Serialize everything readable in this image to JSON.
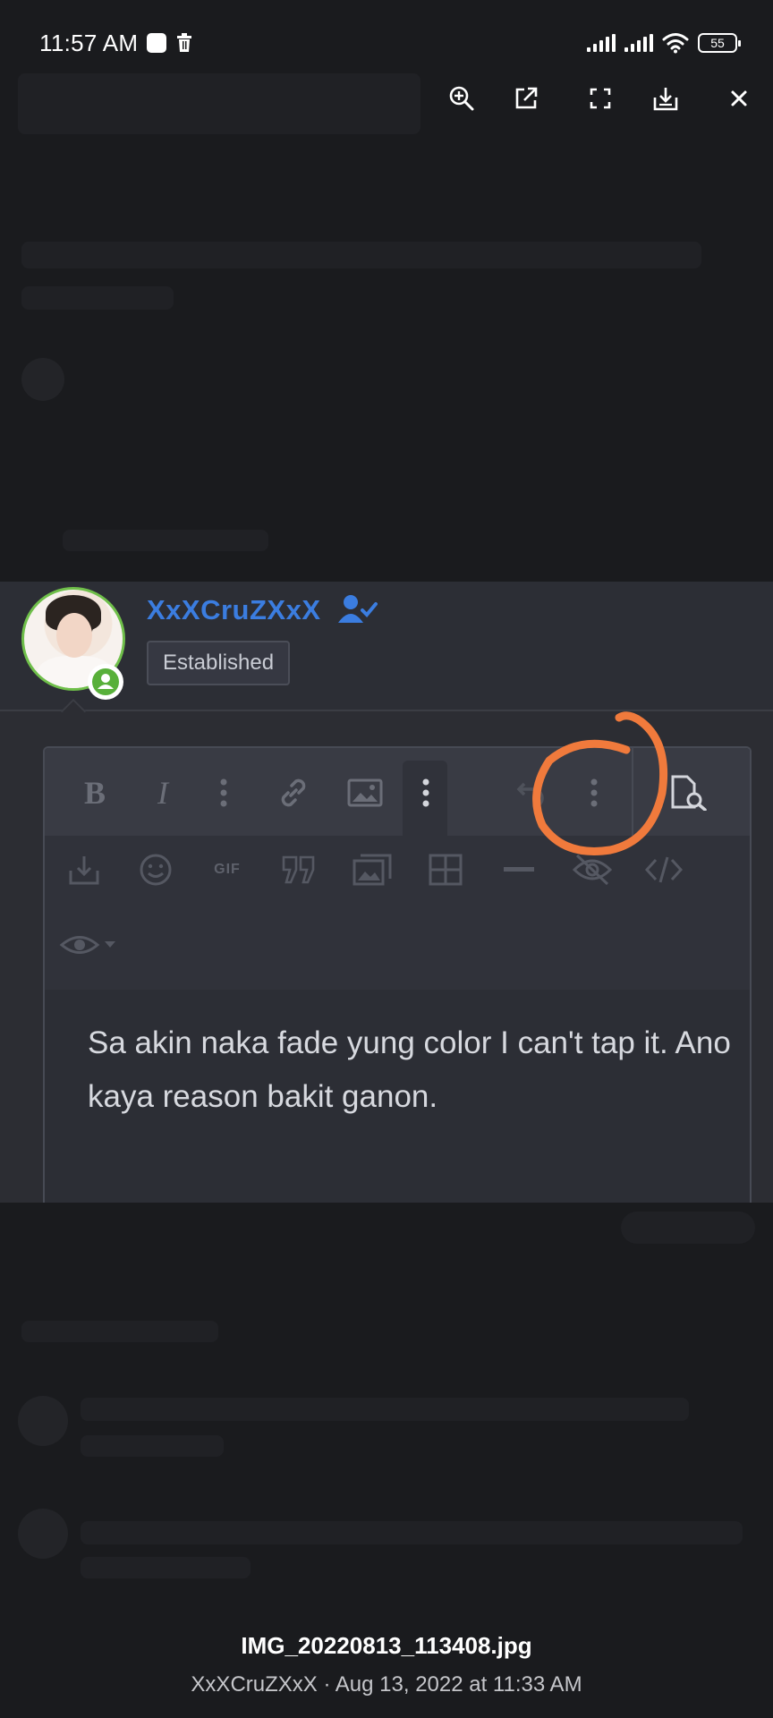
{
  "status_bar": {
    "time": "11:57 AM",
    "battery": "55"
  },
  "viewer_toolbar": {
    "icons": [
      "zoom-in-icon",
      "open-external-icon",
      "fullscreen-icon",
      "download-icon",
      "close-icon"
    ]
  },
  "post": {
    "username": "XxXCruZXxX",
    "rank": "Established",
    "accent_color": "#3b7de0",
    "online_color": "#58b03a",
    "editor_text": "Sa akin naka fade yung color I can't tap it. Ano kaya reason bakit ganon.",
    "toolbar_row1": [
      "B",
      "I"
    ],
    "gif_label": "GIF"
  },
  "annotation": {
    "color": "#f07a3c"
  },
  "caption": {
    "file_name": "IMG_20220813_113408.jpg",
    "meta": "XxXCruZXxX · Aug 13, 2022 at 11:33 AM"
  }
}
